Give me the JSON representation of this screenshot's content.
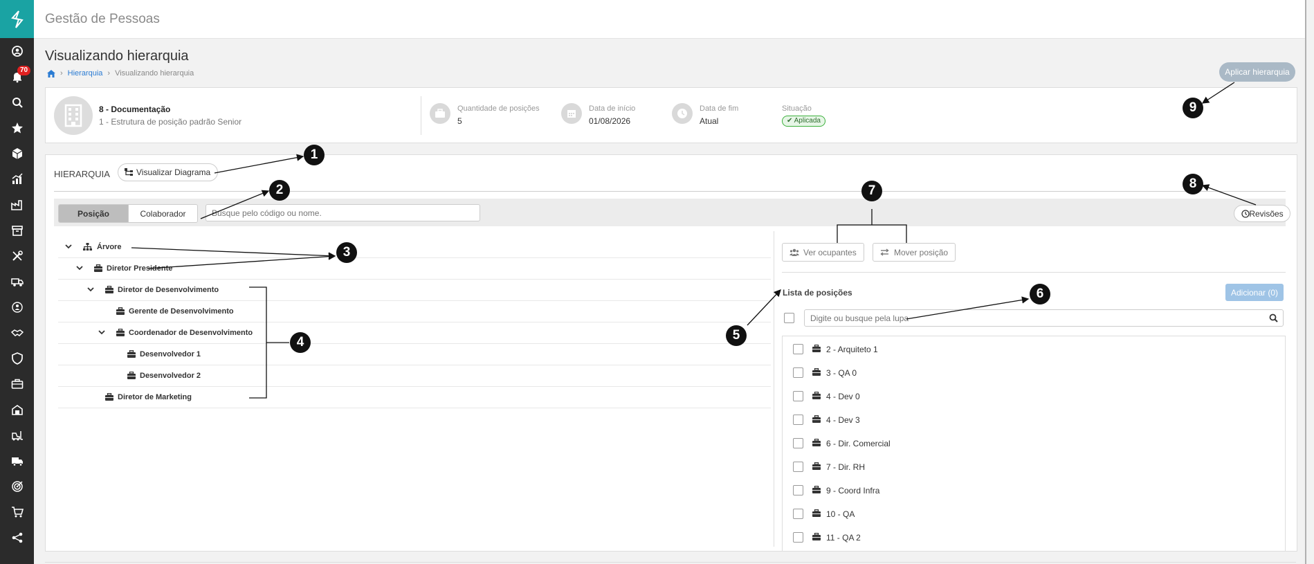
{
  "app": {
    "title": "Gestão de Pessoas"
  },
  "sidebar": {
    "items": [
      {
        "icon": "logo-icon"
      },
      {
        "icon": "user-circle-icon"
      },
      {
        "icon": "bell-icon",
        "badge": "70"
      },
      {
        "icon": "search-icon"
      },
      {
        "icon": "star-icon"
      },
      {
        "icon": "cube-icon"
      },
      {
        "icon": "chart-icon"
      },
      {
        "icon": "factory-icon"
      },
      {
        "icon": "archive-icon"
      },
      {
        "icon": "tools-icon"
      },
      {
        "icon": "truck-loading-icon"
      },
      {
        "icon": "people-cycle-icon"
      },
      {
        "icon": "handshake-icon"
      },
      {
        "icon": "shield-icon"
      },
      {
        "icon": "briefcase-icon"
      },
      {
        "icon": "building-icon"
      },
      {
        "icon": "forklift-icon"
      },
      {
        "icon": "truck-icon"
      },
      {
        "icon": "target-icon"
      },
      {
        "icon": "cart-icon"
      },
      {
        "icon": "share-icon"
      }
    ]
  },
  "page": {
    "title": "Visualizando hierarquia",
    "breadcrumb": {
      "link": "Hierarquia",
      "current": "Visualizando hierarquia"
    },
    "apply_button": "Aplicar hierarquia"
  },
  "info": {
    "unit_name": "8 - Documentação",
    "structure": "1 - Estrutura de posição padrão Senior",
    "positions_label": "Quantidade de posições",
    "positions_value": "5",
    "start_label": "Data de início",
    "start_value": "01/08/2026",
    "end_label": "Data de fim",
    "end_value": "Atual",
    "status_label": "Situação",
    "status_value": "Aplicada"
  },
  "hierarchy": {
    "title": "HIERARQUIA",
    "diagram_button": "Visualizar Diagrama",
    "tabs": [
      "Posição",
      "Colaborador"
    ],
    "search_placeholder": "Busque pelo código ou nome.",
    "revisions_button": "Revisões",
    "tree": [
      {
        "label": "Árvore",
        "expanded": true,
        "icon": "sitemap-icon"
      },
      {
        "label": "Diretor Presidente",
        "expanded": true,
        "icon": "briefcase-icon"
      },
      {
        "label": "Diretor de Desenvolvimento",
        "expanded": true,
        "icon": "briefcase-icon"
      },
      {
        "label": "Gerente de Desenvolvimento",
        "icon": "briefcase-icon"
      },
      {
        "label": "Coordenador de Desenvolvimento",
        "expanded": true,
        "icon": "briefcase-icon"
      },
      {
        "label": "Desenvolvedor 1",
        "icon": "briefcase-icon"
      },
      {
        "label": "Desenvolvedor 2",
        "icon": "briefcase-icon"
      },
      {
        "label": "Diretor de Marketing",
        "icon": "briefcase-icon"
      }
    ]
  },
  "positions_panel": {
    "view_occupants": "Ver ocupantes",
    "move_position": "Mover posição",
    "list_title": "Lista de posições",
    "add_button": "Adicionar (0)",
    "search_placeholder": "Digite ou busque pela lupa",
    "items": [
      "2 - Arquiteto 1",
      "3 - QA 0",
      "4 - Dev 0",
      "4 - Dev 3",
      "6 - Dir. Comercial",
      "7 - Dir. RH",
      "9 - Coord Infra",
      "10 - QA",
      "11 - QA 2"
    ]
  },
  "annotations": [
    "1",
    "2",
    "3",
    "4",
    "5",
    "6",
    "7",
    "8",
    "9"
  ]
}
